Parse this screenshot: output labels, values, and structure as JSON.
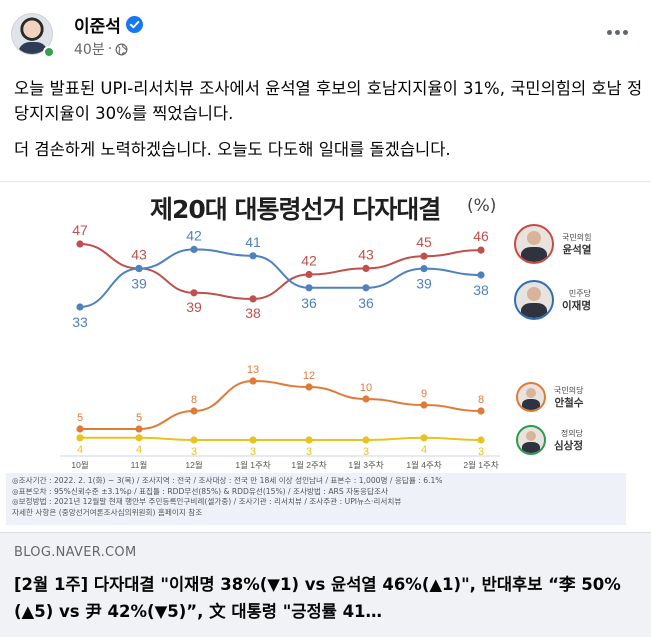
{
  "post": {
    "author": "이준석",
    "time": "40분",
    "separator": "·",
    "text": [
      "오늘 발표된 UPI-리서치뷰 조사에서 윤석열 후보의 호남지지율이 31%, 국민의힘의 호남 정당지지율이 30%를 찍었습니다.",
      "더 겸손하게 노력하겠습니다. 오늘도 다도해 일대를 돌겠습니다."
    ]
  },
  "image": {
    "title": "제20대 대통령선거 다자대결",
    "unit": "(%)",
    "candidates": [
      {
        "party": "국민의힘",
        "name": "윤석열"
      },
      {
        "party": "민주당",
        "name": "이재명"
      },
      {
        "party": "국민의당",
        "name": "안철수"
      },
      {
        "party": "정의당",
        "name": "심상정"
      }
    ],
    "source_lines": [
      "◎조사기간 : 2022. 2. 1(화) ~ 3(목) / 조사지역 : 전국 / 조사대상 : 전국 만 18세 이상 성인남녀 / 표본수 : 1,000명 / 응답률 : 6.1%",
      "◎표본오차 : 95%신뢰수준 ±3.1%p / 표집틀 : RDD무선(85%) & RDD유선(15%) / 조사방법 : ARS 자동응답조사",
      "◎보정방법 : 2021년 12월말 현재 행안부 주민등록인구비례(셀가중) / 조사기관 : 리서치뷰 / 조사주관 : UPI뉴스·리서치뷰",
      "자세한 사항은 (중앙선거여론조사심의위원회) 홈페이지 참조"
    ]
  },
  "link": {
    "domain": "BLOG.NAVER.COM",
    "title": "[2월 1주] 다자대결 \"이재명 38%(▼1) vs 윤석열 46%(▲1)\", 반대후보 “李 50%(▲5) vs 尹 42%(▼5)”, 文 대통령 \"긍정률 41…"
  },
  "icons": {
    "verified": "verified-badge-icon",
    "globe": "globe-icon",
    "more": "more-options-icon"
  },
  "colors": {
    "yoon": "#c0504d",
    "lee": "#4f81bd",
    "ahn": "#e07a38",
    "sim": "#e8c21e",
    "verified": "#1877f2"
  },
  "chart_data": {
    "type": "line",
    "title": "제20대 대통령선거 다자대결",
    "ylabel": "%",
    "categories": [
      "10월",
      "11월",
      "12월",
      "1월 1주차",
      "1월 2주차",
      "1월 3주차",
      "1월 4주차",
      "2월 1주차"
    ],
    "series": [
      {
        "name": "윤석열",
        "values": [
          47,
          43,
          39,
          38,
          42,
          43,
          45,
          46
        ]
      },
      {
        "name": "이재명",
        "values": [
          33,
          39,
          42,
          41,
          36,
          36,
          39,
          38
        ]
      },
      {
        "name": "안철수",
        "values": [
          5,
          5,
          8,
          13,
          12,
          10,
          9,
          8
        ]
      },
      {
        "name": "심상정",
        "values": [
          4,
          4,
          3,
          3,
          3,
          3,
          4,
          3
        ]
      }
    ],
    "grid": false,
    "legend": "right"
  }
}
